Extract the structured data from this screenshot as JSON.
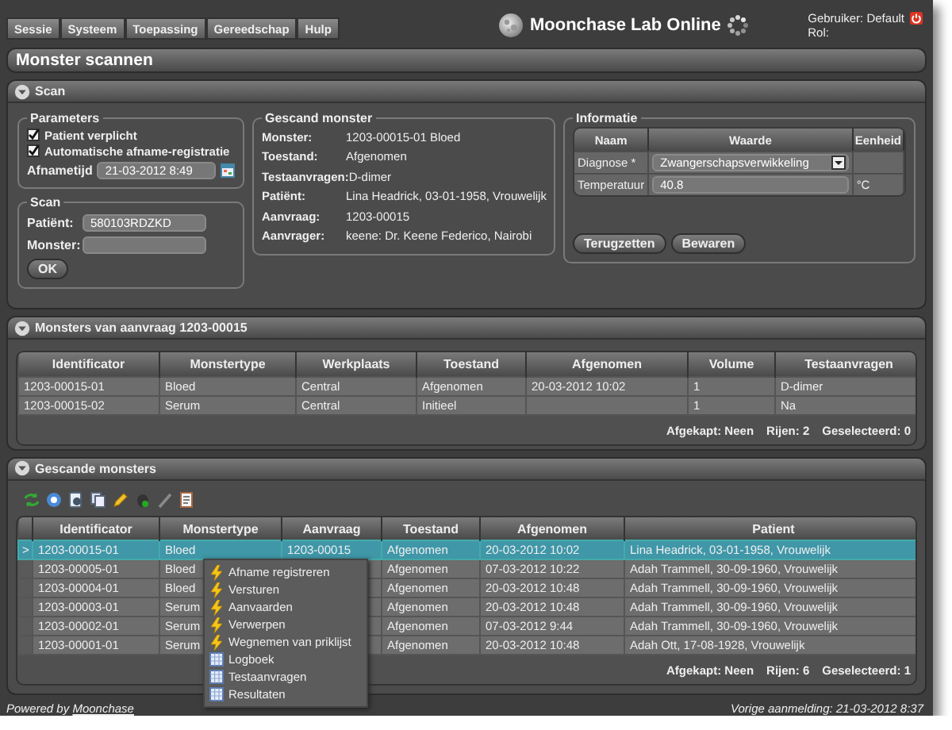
{
  "menu": [
    {
      "label": "Sessie"
    },
    {
      "label": "Systeem"
    },
    {
      "label": "Toepassing"
    },
    {
      "label": "Gereedschap"
    },
    {
      "label": "Hulp"
    }
  ],
  "app_title": "Moonchase Lab Online",
  "user": {
    "name": "Gebruiker: Default",
    "role": "Rol:"
  },
  "page_title": "Monster scannen",
  "scan_panel": {
    "title": "Scan",
    "parameters": {
      "title": "Parameters",
      "checkboxes": [
        {
          "label": "Patient verplicht",
          "checked": true
        },
        {
          "label": "Automatische afname-registratie",
          "checked": true
        }
      ],
      "time": {
        "label": "Afnametijd",
        "value": "21-03-2012 8:49"
      }
    },
    "scan": {
      "title": "Scan",
      "fields": [
        {
          "label": "Patiënt:",
          "value": "580103RDZKD"
        },
        {
          "label": "Monster:"
        }
      ],
      "button": "OK"
    },
    "scanned": {
      "title": "Gescand monster",
      "rows": [
        {
          "label": "Monster:",
          "value": "1203-00015-01 Bloed"
        },
        {
          "label": "Toestand:",
          "value": "Afgenomen"
        },
        {
          "label": "Testaanvragen:",
          "value": "D-dimer"
        },
        {
          "label": "Patiënt:",
          "value": "Lina Headrick, 03-01-1958, Vrouwelijk"
        },
        {
          "label": "Aanvraag:",
          "value": "1203-00015"
        },
        {
          "label": "Aanvrager:",
          "value": "keene: Dr. Keene Federico, Nairobi"
        }
      ]
    },
    "info": {
      "title": "Informatie",
      "columns": [
        "Naam",
        "Waarde",
        "Eenheid"
      ],
      "rows": [
        {
          "name": "Diagnose *",
          "kind": "select",
          "value": "Zwangerschapsverwikkeling"
        },
        {
          "name": "Temperatuur",
          "kind": "input",
          "value": "40.8",
          "unit": "°C"
        }
      ],
      "buttons": [
        "Terugzetten",
        "Bewaren"
      ]
    }
  },
  "samples_panel": {
    "title": "Monsters van aanvraag 1203-00015",
    "columns": [
      "Identificator",
      "Monstertype",
      "Werkplaats",
      "Toestand",
      "Afgenomen",
      "Volume",
      "Testaanvragen"
    ],
    "rows": [
      {
        "selected": false,
        "cells": [
          "1203-00015-01",
          "Bloed",
          "Central",
          "Afgenomen",
          "20-03-2012 10:02",
          "1",
          "D-dimer"
        ]
      },
      {
        "selected": false,
        "cells": [
          "1203-00015-02",
          "Serum",
          "Central",
          "Initieel",
          null,
          "1",
          "Na"
        ]
      }
    ],
    "footer": [
      "Afgekapt: Neen",
      "Rijen: 2",
      "Geselecteerd: 0"
    ]
  },
  "scanned_panel": {
    "title": "Gescande monsters",
    "row_marker": ">",
    "columns": [
      "Identificator",
      "Monstertype",
      "Aanvraag",
      "Toestand",
      "Afgenomen",
      "Patient"
    ],
    "rows": [
      {
        "selected": true,
        "cells": [
          "1203-00015-01",
          "Bloed",
          "1203-00015",
          "Afgenomen",
          "20-03-2012 10:02",
          "Lina Headrick, 03-01-1958, Vrouwelijk"
        ]
      },
      {
        "selected": false,
        "cells": [
          "1203-00005-01",
          "Bloed",
          null,
          "Afgenomen",
          "07-03-2012 10:22",
          "Adah Trammell, 30-09-1960, Vrouwelijk"
        ]
      },
      {
        "selected": false,
        "cells": [
          "1203-00004-01",
          "Bloed",
          null,
          "Afgenomen",
          "20-03-2012 10:48",
          "Adah Trammell, 30-09-1960, Vrouwelijk"
        ]
      },
      {
        "selected": false,
        "cells": [
          "1203-00003-01",
          "Serum",
          null,
          "Afgenomen",
          "20-03-2012 10:48",
          "Adah Trammell, 30-09-1960, Vrouwelijk"
        ]
      },
      {
        "selected": false,
        "cells": [
          "1203-00002-01",
          "Serum",
          null,
          "Afgenomen",
          "07-03-2012 9:44",
          "Adah Trammell, 30-09-1960, Vrouwelijk"
        ]
      },
      {
        "selected": false,
        "cells": [
          "1203-00001-01",
          "Serum",
          null,
          "Afgenomen",
          "20-03-2012 10:48",
          "Adah Ott, 17-08-1928, Vrouwelijk"
        ]
      }
    ],
    "footer": [
      "Afgekapt: Neen",
      "Rijen: 6",
      "Geselecteerd: 1"
    ]
  },
  "context_menu": [
    {
      "label": "Afname registreren",
      "kind": "action"
    },
    {
      "label": "Versturen",
      "kind": "action"
    },
    {
      "label": "Aanvaarden",
      "kind": "action"
    },
    {
      "label": "Verwerpen",
      "kind": "action"
    },
    {
      "label": "Wegnemen van priklijst",
      "kind": "action"
    },
    {
      "label": "Logboek",
      "kind": "view"
    },
    {
      "label": "Testaanvragen",
      "kind": "view"
    },
    {
      "label": "Resultaten",
      "kind": "view"
    }
  ],
  "footer": {
    "powered": "Powered by",
    "link": "Moonchase",
    "last_login": "Vorige aanmelding: 21-03-2012 8:37"
  }
}
